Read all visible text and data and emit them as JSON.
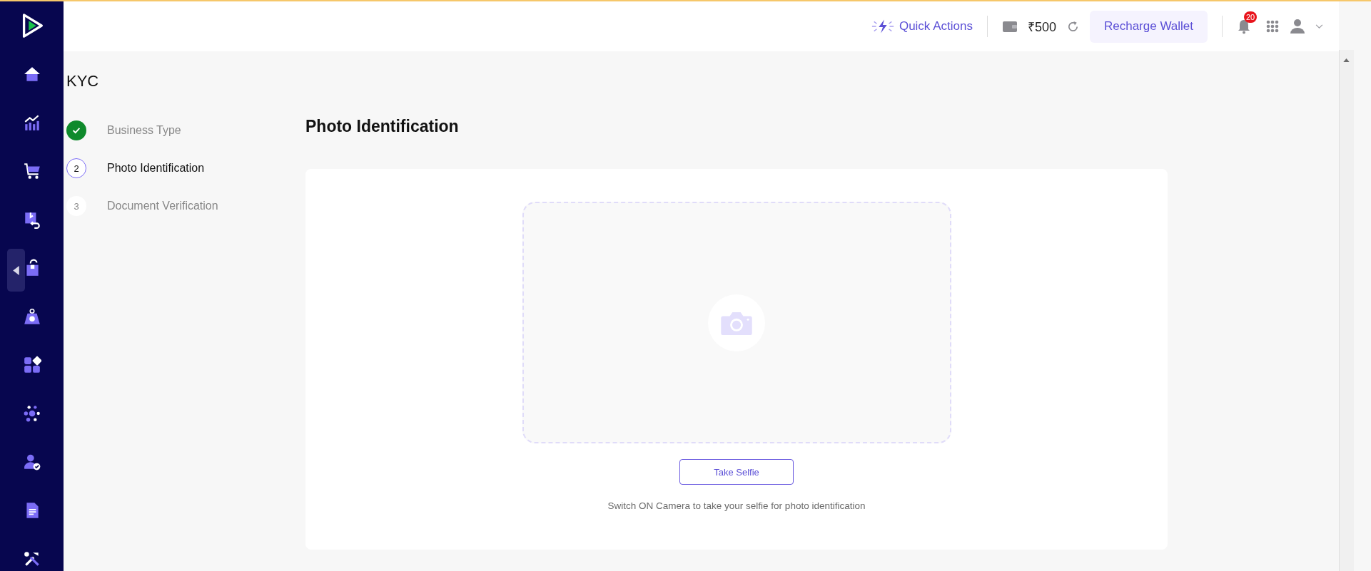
{
  "header": {
    "quick_actions": "Quick Actions",
    "wallet_balance": "₹500",
    "recharge_button": "Recharge Wallet",
    "notification_count": "20"
  },
  "page_title": "KYC",
  "steps": [
    {
      "label": "Business Type",
      "kind": "done",
      "selected": false
    },
    {
      "number": "2",
      "label": "Photo Identification",
      "kind": "current",
      "selected": true
    },
    {
      "number": "3",
      "label": "Document Verification",
      "kind": "pending",
      "selected": false
    }
  ],
  "section": {
    "heading": "Photo Identification",
    "button": "Take Selfie",
    "hint": "Switch ON Camera to take your selfie for photo identification"
  }
}
